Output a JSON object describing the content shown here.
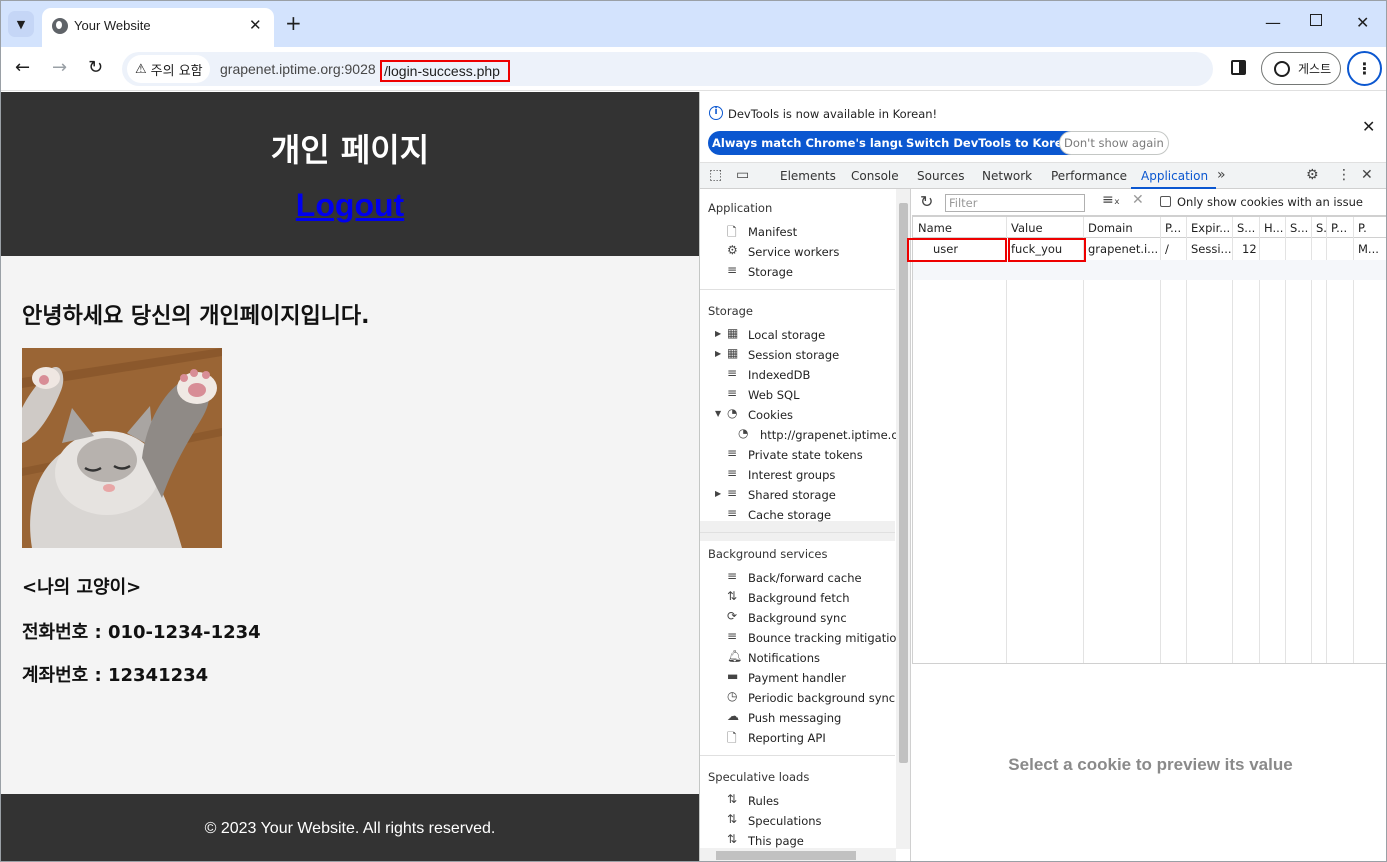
{
  "browser": {
    "tab_title": "Your Website",
    "new_tab": "+",
    "security_chip": "주의 요함",
    "url_host": "grapenet.iptime.org:9028",
    "url_path": "/login-success.php",
    "guest_label": "게스트"
  },
  "page": {
    "title": "개인 페이지",
    "logout": "Logout",
    "greeting": "안녕하세요 당신의 개인페이지입니다.",
    "cat_caption": "<나의 고양이>",
    "phone": "전화번호 : 010-1234-1234",
    "account": "계좌번호 : 12341234",
    "footer": "© 2023 Your Website. All rights reserved."
  },
  "devtools": {
    "info_text": "DevTools is now available in Korean!",
    "btn_match": "Always match Chrome's language",
    "btn_switch": "Switch DevTools to Korean",
    "btn_dont_show": "Don't show again",
    "tabs": [
      "Elements",
      "Console",
      "Sources",
      "Network",
      "Performance",
      "Application"
    ],
    "active_tab": "Application",
    "sidebar": {
      "application_header": "Application",
      "application_items": [
        "Manifest",
        "Service workers",
        "Storage"
      ],
      "storage_header": "Storage",
      "storage_items": [
        "Local storage",
        "Session storage",
        "IndexedDB",
        "Web SQL",
        "Cookies",
        "http://grapenet.iptime.org",
        "Private state tokens",
        "Interest groups",
        "Shared storage",
        "Cache storage"
      ],
      "background_header": "Background services",
      "background_items": [
        "Back/forward cache",
        "Background fetch",
        "Background sync",
        "Bounce tracking mitigations",
        "Notifications",
        "Payment handler",
        "Periodic background sync",
        "Push messaging",
        "Reporting API"
      ],
      "speculative_header": "Speculative loads",
      "speculative_items": [
        "Rules",
        "Speculations",
        "This page"
      ]
    },
    "cookies": {
      "filter_placeholder": "Filter",
      "only_issue_label": "Only show cookies with an issue",
      "columns": [
        "Name",
        "Value",
        "Domain",
        "P...",
        "Expir...",
        "S...",
        "H...",
        "S...",
        "S.",
        "P...",
        "P."
      ],
      "rows": [
        [
          "user",
          "fuck_you",
          "grapenet.i...",
          "/",
          "Sessi...",
          "12",
          "",
          "",
          "",
          "",
          "M..."
        ]
      ],
      "preview_placeholder": "Select a cookie to preview its value"
    }
  }
}
